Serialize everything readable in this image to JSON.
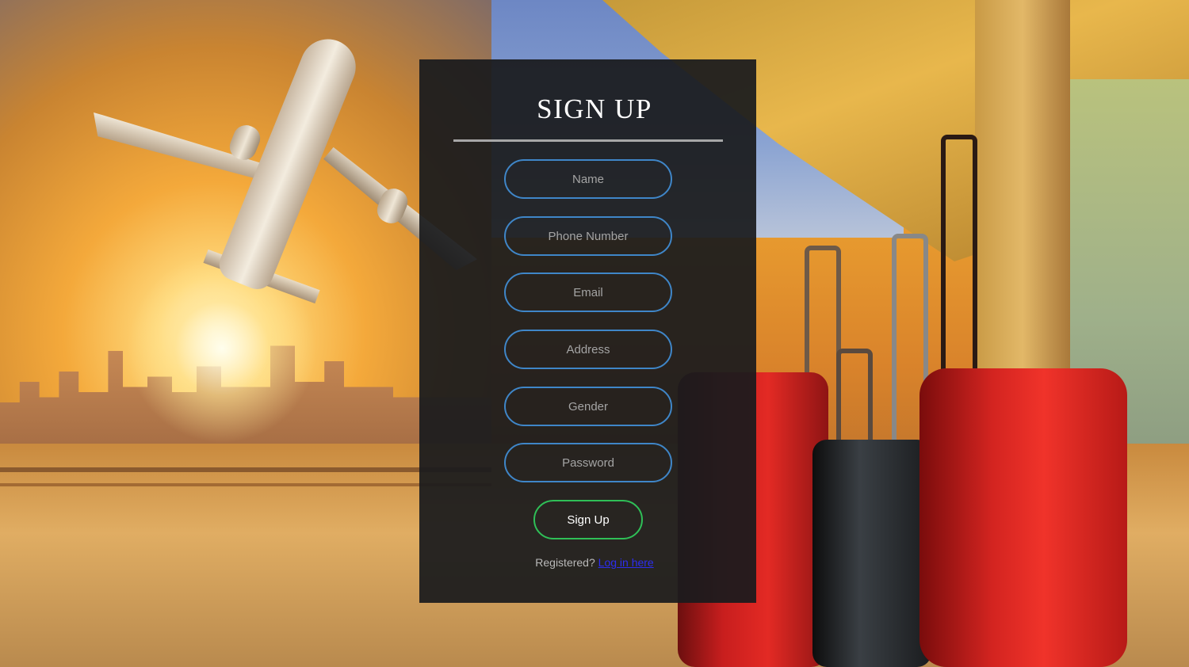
{
  "form": {
    "title": "SIGN UP",
    "fields": [
      {
        "placeholder": "Name"
      },
      {
        "placeholder": "Phone Number"
      },
      {
        "placeholder": "Email"
      },
      {
        "placeholder": "Address"
      },
      {
        "placeholder": "Gender"
      },
      {
        "placeholder": "Password"
      }
    ],
    "submit_label": "Sign Up",
    "footer_text": "Registered?",
    "footer_link": "Log in here"
  },
  "colors": {
    "panel_bg": "#1a1b1d",
    "field_border": "#3f86c8",
    "submit_border": "#2fbf57",
    "link": "#2d2df0"
  },
  "background": {
    "icons": [
      "airplane-icon",
      "suitcase-icon"
    ]
  }
}
